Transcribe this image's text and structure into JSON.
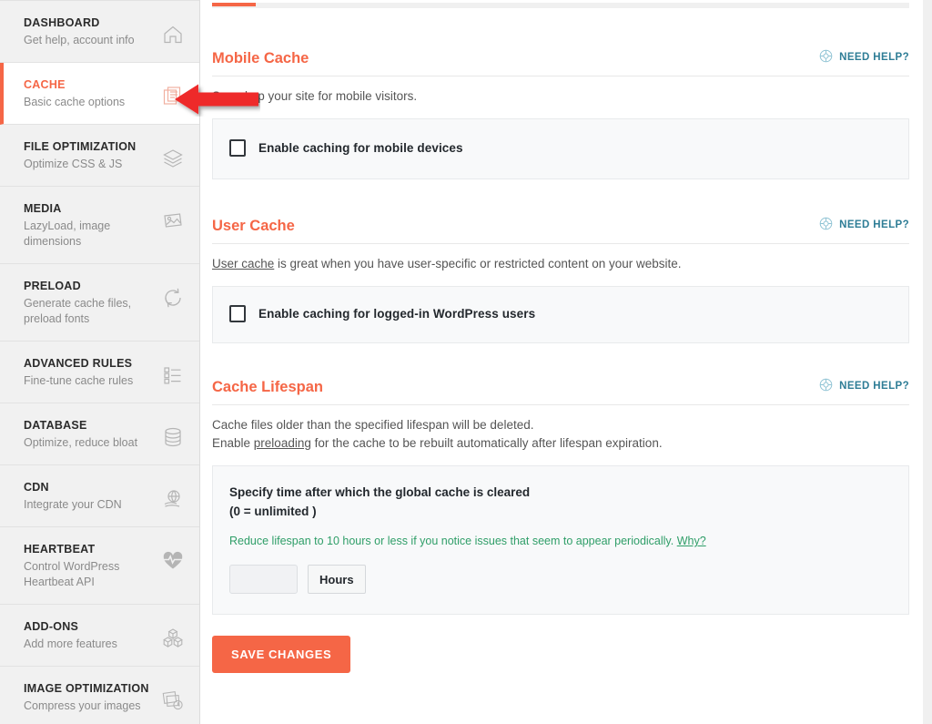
{
  "sidebar": {
    "items": [
      {
        "title": "DASHBOARD",
        "subtitle": "Get help, account info",
        "icon": "home-icon",
        "active": false
      },
      {
        "title": "CACHE",
        "subtitle": "Basic cache options",
        "icon": "cache-pages-icon",
        "active": true
      },
      {
        "title": "FILE OPTIMIZATION",
        "subtitle": "Optimize CSS & JS",
        "icon": "layers-icon",
        "active": false
      },
      {
        "title": "MEDIA",
        "subtitle": "LazyLoad, image dimensions",
        "icon": "image-icon",
        "active": false
      },
      {
        "title": "PRELOAD",
        "subtitle": "Generate cache files, preload fonts",
        "icon": "refresh-icon",
        "active": false
      },
      {
        "title": "ADVANCED RULES",
        "subtitle": "Fine-tune cache rules",
        "icon": "list-rules-icon",
        "active": false
      },
      {
        "title": "DATABASE",
        "subtitle": "Optimize, reduce bloat",
        "icon": "database-icon",
        "active": false
      },
      {
        "title": "CDN",
        "subtitle": "Integrate your CDN",
        "icon": "cdn-globe-icon",
        "active": false
      },
      {
        "title": "HEARTBEAT",
        "subtitle": "Control WordPress Heartbeat API",
        "icon": "heartbeat-icon",
        "active": false
      },
      {
        "title": "ADD-ONS",
        "subtitle": "Add more features",
        "icon": "cubes-icon",
        "active": false
      },
      {
        "title": "IMAGE OPTIMIZATION",
        "subtitle": "Compress your images",
        "icon": "image-stack-icon",
        "active": false
      }
    ]
  },
  "main": {
    "need_help_label": "NEED HELP?",
    "sections": [
      {
        "title": "Mobile Cache",
        "description": "Speed up your site for mobile visitors.",
        "checkbox_label": "Enable caching for mobile devices",
        "checked": false
      },
      {
        "title": "User Cache",
        "description_link": "User cache",
        "description_rest": " is great when you have user-specific or restricted content on your website.",
        "checkbox_label": "Enable caching for logged-in WordPress users",
        "checked": false
      }
    ],
    "cache_lifespan": {
      "title": "Cache Lifespan",
      "desc_line1": "Cache files older than the specified lifespan will be deleted.",
      "desc_line2_prefix": "Enable ",
      "desc_line2_link": "preloading",
      "desc_line2_suffix": " for the cache to be rebuilt automatically after lifespan expiration.",
      "panel_title_line1": "Specify time after which the global cache is cleared",
      "panel_title_line2": "(0 = unlimited )",
      "note": "Reduce lifespan to 10 hours or less if you notice issues that seem to appear periodically.",
      "note_link": "Why?",
      "input_value": "",
      "input_placeholder": "",
      "unit_label": "Hours"
    },
    "save_label": "SAVE CHANGES"
  },
  "colors": {
    "accent": "#f56646",
    "need_help": "#2e7d96",
    "note_green": "#2f9e68",
    "annotation_arrow": "#ee2b2b"
  }
}
